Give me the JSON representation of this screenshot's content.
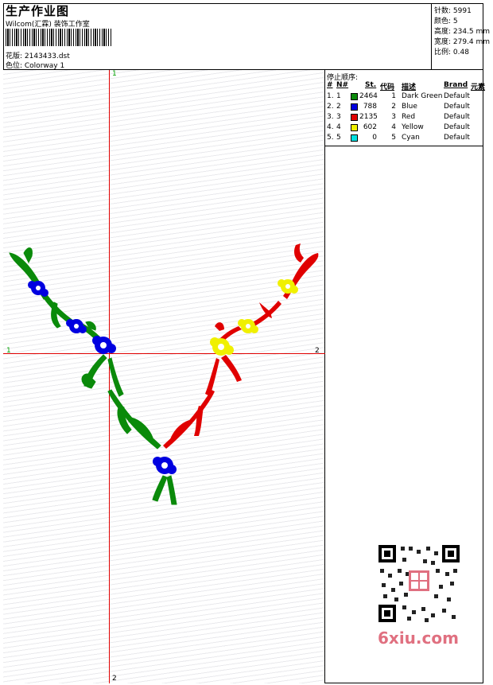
{
  "header": {
    "title": "生产作业图",
    "subtitle": "Wilcom(汇霖) 装饰工作室",
    "file_label": "花版: 2143433.dst",
    "color_label": "色位: Colorway 1"
  },
  "stats": {
    "stitches": "针数: 5991",
    "colors": "颜色: 5",
    "height": "高度: 234.5 mm",
    "width": "宽度: 279.4 mm",
    "scale": "比例: 0.48"
  },
  "axis_marks": {
    "top": "1",
    "left": "1",
    "right": "2",
    "bottom": "2"
  },
  "legend": {
    "title": "停止顺序:",
    "headers": [
      "#",
      "N#",
      "St.",
      "代码",
      "描述",
      "Brand",
      "元素"
    ],
    "rows": [
      {
        "num": "1.",
        "n": "1",
        "st": "2464",
        "code": "1",
        "desc": "Dark Green",
        "brand": "Default",
        "color": "#0a8a0a"
      },
      {
        "num": "2.",
        "n": "2",
        "st": "788",
        "code": "2",
        "desc": "Blue",
        "brand": "Default",
        "color": "#0000e0"
      },
      {
        "num": "3.",
        "n": "3",
        "st": "2135",
        "code": "3",
        "desc": "Red",
        "brand": "Default",
        "color": "#e00000"
      },
      {
        "num": "4.",
        "n": "4",
        "st": "602",
        "code": "4",
        "desc": "Yellow",
        "brand": "Default",
        "color": "#f0f000"
      },
      {
        "num": "5.",
        "n": "5",
        "st": "0",
        "code": "5",
        "desc": "Cyan",
        "brand": "Default",
        "color": "#00e0e0"
      }
    ]
  },
  "watermark": {
    "brand_text": "6xiu.com"
  }
}
